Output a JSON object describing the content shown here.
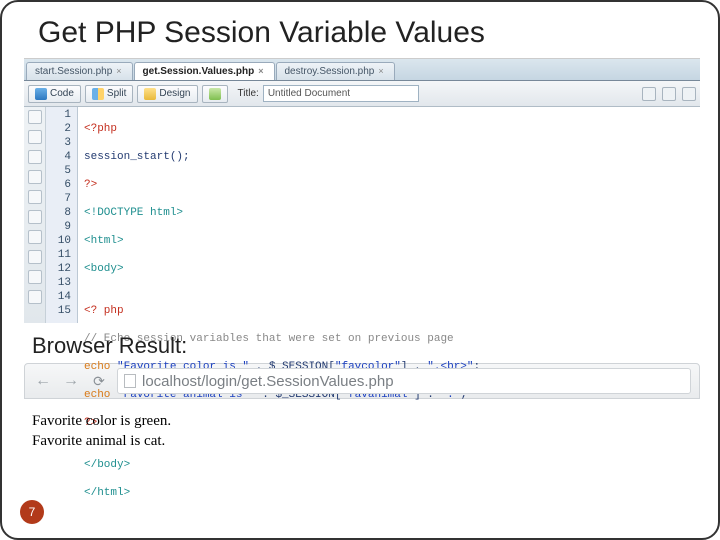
{
  "slide": {
    "title": "Get PHP Session Variable Values",
    "page_number": "7",
    "result_label": "Browser Result:"
  },
  "editor": {
    "tabs": [
      {
        "label": "start.Session.php",
        "active": false
      },
      {
        "label": "get.Session.Values.php",
        "active": true
      },
      {
        "label": "destroy.Session.php",
        "active": false
      }
    ],
    "views": {
      "code": "Code",
      "split": "Split",
      "design": "Design"
    },
    "title_label": "Title:",
    "title_value": "Untitled Document",
    "line_numbers": [
      "1",
      "2",
      "3",
      "4",
      "5",
      "6",
      "7",
      "8",
      "9",
      "10",
      "11",
      "12",
      "13",
      "14",
      "15"
    ],
    "code": {
      "l1": "<?php",
      "l2": "session_start();",
      "l3": "?>",
      "l4": "<!DOCTYPE html>",
      "l5": "<html>",
      "l6": "<body>",
      "l7": "",
      "l8": "<? php",
      "l9": "// Echo session variables that were set on previous page",
      "l10a": "echo ",
      "l10b": "\"Favorite color is \"",
      "l10c": " . $_SESSION[",
      "l10d": "\"favcolor\"",
      "l10e": "] . ",
      "l10f": "\".<br>\"",
      "l10g": ";",
      "l11a": "echo ",
      "l11b": "\"Favorite animal is \"",
      "l11c": " . $_SESSION[",
      "l11d": "\"favanimal\"",
      "l11e": "] . ",
      "l11f": "\".\"",
      "l11g": ";",
      "l12": "?>",
      "l13": "",
      "l14": "</body>",
      "l15": "</html>"
    }
  },
  "browser": {
    "url": "localhost/login/get.SessionValues.php",
    "output_line1": "Favorite color is green.",
    "output_line2": "Favorite animal is cat."
  }
}
